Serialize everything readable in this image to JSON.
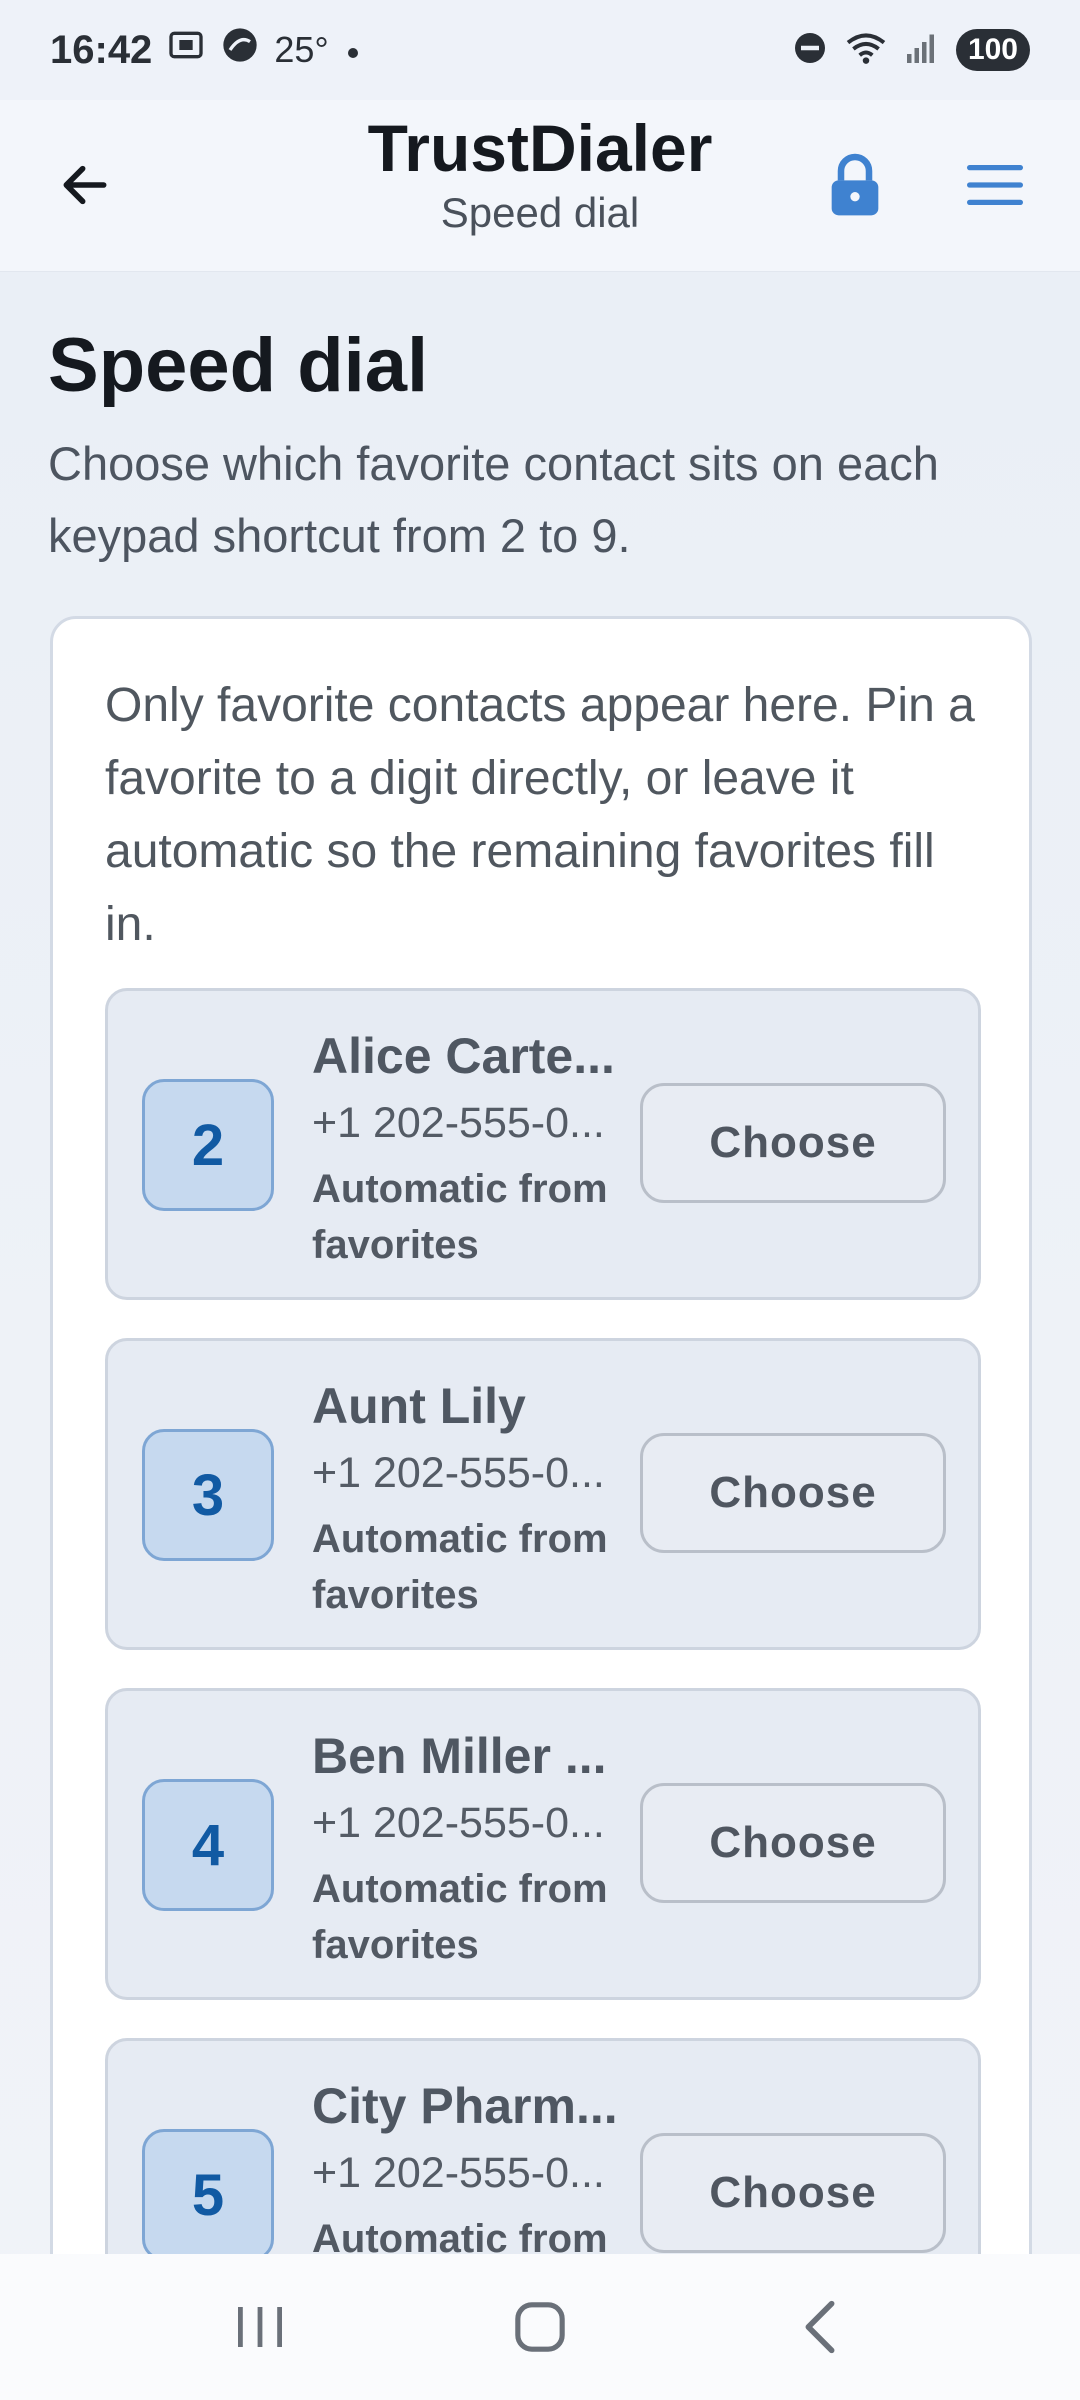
{
  "status": {
    "time": "16:42",
    "temp": "25°",
    "battery": "100"
  },
  "appbar": {
    "title": "TrustDialer",
    "subtitle": "Speed dial"
  },
  "page": {
    "heading": "Speed dial",
    "description": "Choose which favorite contact sits on each keypad shortcut from 2 to 9."
  },
  "card": {
    "info": "Only favorite contacts appear here. Pin a favorite to a digit directly, or leave it automatic so the remaining favorites fill in."
  },
  "slots": [
    {
      "digit": "2",
      "name": "Alice Carte...",
      "phone": "+1 202-555-0...",
      "note": "Automatic from favorites",
      "button": "Choose"
    },
    {
      "digit": "3",
      "name": "Aunt Lily",
      "phone": "+1 202-555-0...",
      "note": "Automatic from favorites",
      "button": "Choose"
    },
    {
      "digit": "4",
      "name": "Ben Miller ...",
      "phone": "+1 202-555-0...",
      "note": "Automatic from favorites",
      "button": "Choose"
    },
    {
      "digit": "5",
      "name": "City Pharm...",
      "phone": "+1 202-555-0...",
      "note": "Automatic from favorites",
      "button": "Choose"
    }
  ],
  "colors": {
    "accent": "#115aa3",
    "lock": "#3f82d0",
    "menu": "#3f82d0"
  }
}
